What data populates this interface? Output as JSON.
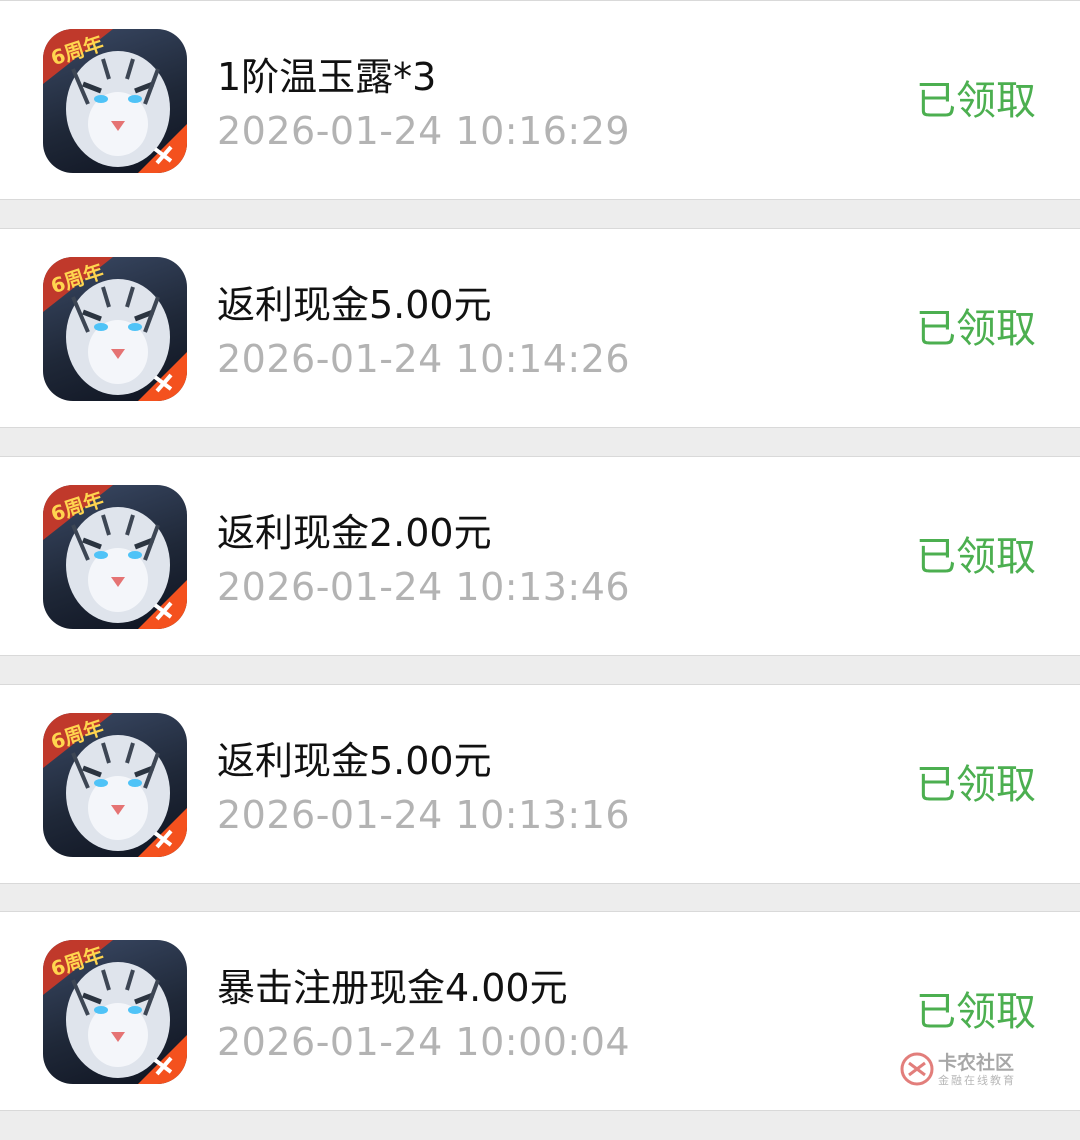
{
  "records": [
    {
      "title": "1阶温玉露*3",
      "time": "2026-01-24 10:16:29",
      "status": "已领取",
      "icon": "game-app-icon"
    },
    {
      "title": "返利现金5.00元",
      "time": "2026-01-24 10:14:26",
      "status": "已领取",
      "icon": "game-app-icon"
    },
    {
      "title": "返利现金2.00元",
      "time": "2026-01-24 10:13:46",
      "status": "已领取",
      "icon": "game-app-icon"
    },
    {
      "title": "返利现金5.00元",
      "time": "2026-01-24 10:13:16",
      "status": "已领取",
      "icon": "game-app-icon"
    },
    {
      "title": "暴击注册现金4.00元",
      "time": "2026-01-24 10:00:04",
      "status": "已领取",
      "icon": "game-app-icon"
    }
  ],
  "icon_badge": "6周年",
  "watermark": {
    "title": "卡农社区",
    "subtitle": "金融在线教育"
  },
  "colors": {
    "status": "#4caf50",
    "title": "#111111",
    "time": "#b3b3b3",
    "background": "#ededed",
    "row": "#ffffff"
  }
}
